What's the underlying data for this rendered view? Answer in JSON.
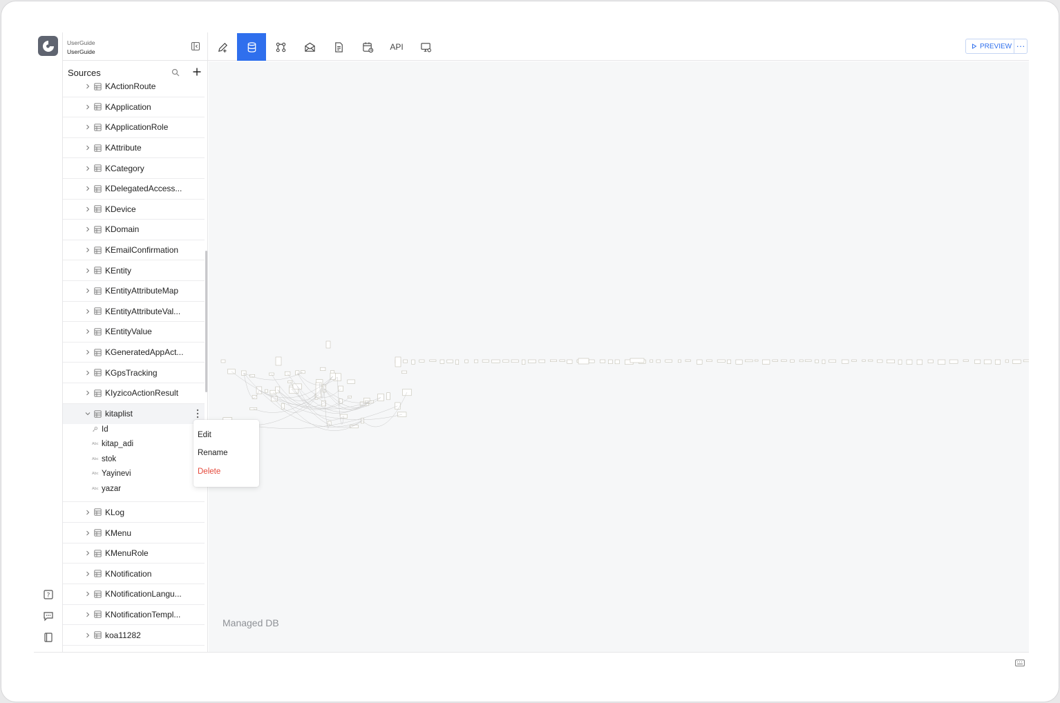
{
  "project": {
    "org": "UserGuide",
    "name": "UserGuide"
  },
  "toolbar": {
    "items": [
      {
        "name": "edit-design-icon"
      },
      {
        "name": "database-icon",
        "active": true
      },
      {
        "name": "workflow-icon"
      },
      {
        "name": "email-icon"
      },
      {
        "name": "document-icon"
      },
      {
        "name": "scheduler-icon"
      },
      {
        "name": "api",
        "label": "API"
      },
      {
        "name": "settings-screen-icon"
      }
    ],
    "preview_label": "PREVIEW"
  },
  "sources": {
    "title": "Sources",
    "tables_above": [
      "KActionRoute",
      "KApplication",
      "KApplicationRole",
      "KAttribute",
      "KCategory",
      "KDelegatedAccess...",
      "KDevice",
      "KDomain",
      "KEmailConfirmation",
      "KEntity",
      "KEntityAttributeMap",
      "KEntityAttributeVal...",
      "KEntityValue",
      "KGeneratedAppAct...",
      "KGpsTracking",
      "KIyzicoActionResult"
    ],
    "expanded_table": {
      "name": "kitaplist",
      "fields": [
        {
          "type": "key",
          "name": "Id"
        },
        {
          "type": "Abc",
          "name": "kitap_adi"
        },
        {
          "type": "Abc",
          "name": "stok"
        },
        {
          "type": "Abc",
          "name": "Yayinevi"
        },
        {
          "type": "Abc",
          "name": "yazar"
        }
      ]
    },
    "tables_below": [
      "KLog",
      "KMenu",
      "KMenuRole",
      "KNotification",
      "KNotificationLangu...",
      "KNotificationTempl...",
      "koa11282"
    ]
  },
  "context_menu": {
    "edit": "Edit",
    "rename": "Rename",
    "delete": "Delete"
  },
  "canvas": {
    "label": "Managed DB"
  },
  "colors": {
    "accent": "#2f6fed",
    "danger": "#e5483a",
    "canvas_bg": "#f6f7f8"
  }
}
